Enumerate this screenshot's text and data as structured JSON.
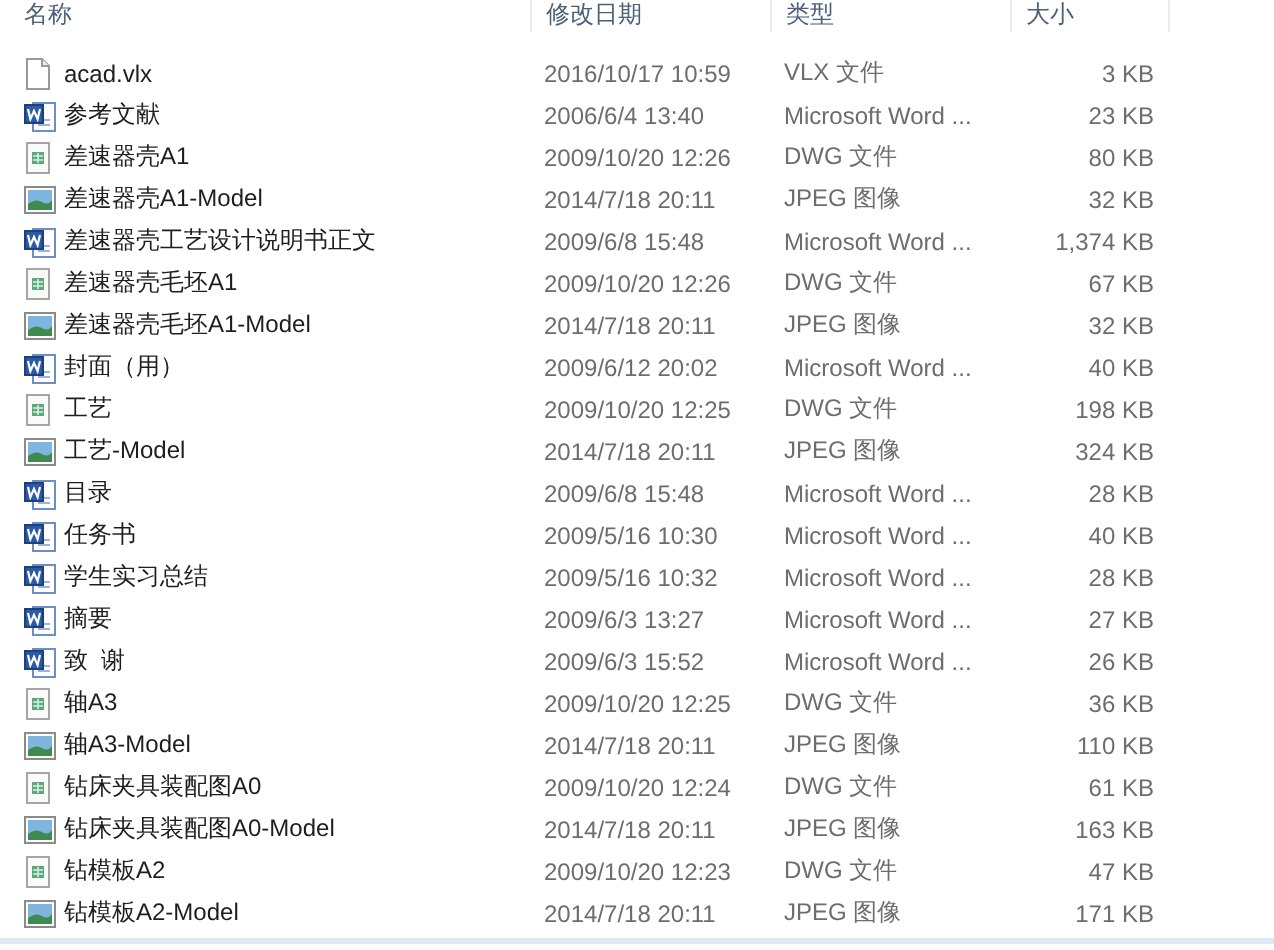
{
  "columns": [
    "名称",
    "修改日期",
    "类型",
    "大小"
  ],
  "files": [
    {
      "kind": "vlx",
      "name": "acad.vlx",
      "date": "2016/10/17 10:59",
      "type": "VLX 文件",
      "size": "3 KB"
    },
    {
      "kind": "word",
      "name": "参考文献",
      "date": "2006/6/4 13:40",
      "type": "Microsoft Word ...",
      "size": "23 KB"
    },
    {
      "kind": "dwg",
      "name": "差速器壳A1",
      "date": "2009/10/20 12:26",
      "type": "DWG 文件",
      "size": "80 KB"
    },
    {
      "kind": "jpeg",
      "name": "差速器壳A1-Model",
      "date": "2014/7/18 20:11",
      "type": "JPEG 图像",
      "size": "32 KB"
    },
    {
      "kind": "word",
      "name": "差速器壳工艺设计说明书正文",
      "date": "2009/6/8 15:48",
      "type": "Microsoft Word ...",
      "size": "1,374 KB"
    },
    {
      "kind": "dwg",
      "name": "差速器壳毛坯A1",
      "date": "2009/10/20 12:26",
      "type": "DWG 文件",
      "size": "67 KB"
    },
    {
      "kind": "jpeg",
      "name": "差速器壳毛坯A1-Model",
      "date": "2014/7/18 20:11",
      "type": "JPEG 图像",
      "size": "32 KB"
    },
    {
      "kind": "word",
      "name": "封面（用）",
      "date": "2009/6/12 20:02",
      "type": "Microsoft Word ...",
      "size": "40 KB"
    },
    {
      "kind": "dwg",
      "name": "工艺",
      "date": "2009/10/20 12:25",
      "type": "DWG 文件",
      "size": "198 KB"
    },
    {
      "kind": "jpeg",
      "name": "工艺-Model",
      "date": "2014/7/18 20:11",
      "type": "JPEG 图像",
      "size": "324 KB"
    },
    {
      "kind": "word",
      "name": "目录",
      "date": "2009/6/8 15:48",
      "type": "Microsoft Word ...",
      "size": "28 KB"
    },
    {
      "kind": "word",
      "name": "任务书",
      "date": "2009/5/16 10:30",
      "type": "Microsoft Word ...",
      "size": "40 KB"
    },
    {
      "kind": "word",
      "name": "学生实习总结",
      "date": "2009/5/16 10:32",
      "type": "Microsoft Word ...",
      "size": "28 KB"
    },
    {
      "kind": "word",
      "name": "摘要",
      "date": "2009/6/3 13:27",
      "type": "Microsoft Word ...",
      "size": "27 KB"
    },
    {
      "kind": "word",
      "name": "致  谢",
      "date": "2009/6/3 15:52",
      "type": "Microsoft Word ...",
      "size": "26 KB"
    },
    {
      "kind": "dwg",
      "name": "轴A3",
      "date": "2009/10/20 12:25",
      "type": "DWG 文件",
      "size": "36 KB"
    },
    {
      "kind": "jpeg",
      "name": "轴A3-Model",
      "date": "2014/7/18 20:11",
      "type": "JPEG 图像",
      "size": "110 KB"
    },
    {
      "kind": "dwg",
      "name": "钻床夹具装配图A0",
      "date": "2009/10/20 12:24",
      "type": "DWG 文件",
      "size": "61 KB"
    },
    {
      "kind": "jpeg",
      "name": "钻床夹具装配图A0-Model",
      "date": "2014/7/18 20:11",
      "type": "JPEG 图像",
      "size": "163 KB"
    },
    {
      "kind": "dwg",
      "name": "钻模板A2",
      "date": "2009/10/20 12:23",
      "type": "DWG 文件",
      "size": "47 KB"
    },
    {
      "kind": "jpeg",
      "name": "钻模板A2-Model",
      "date": "2014/7/18 20:11",
      "type": "JPEG 图像",
      "size": "171 KB"
    }
  ]
}
